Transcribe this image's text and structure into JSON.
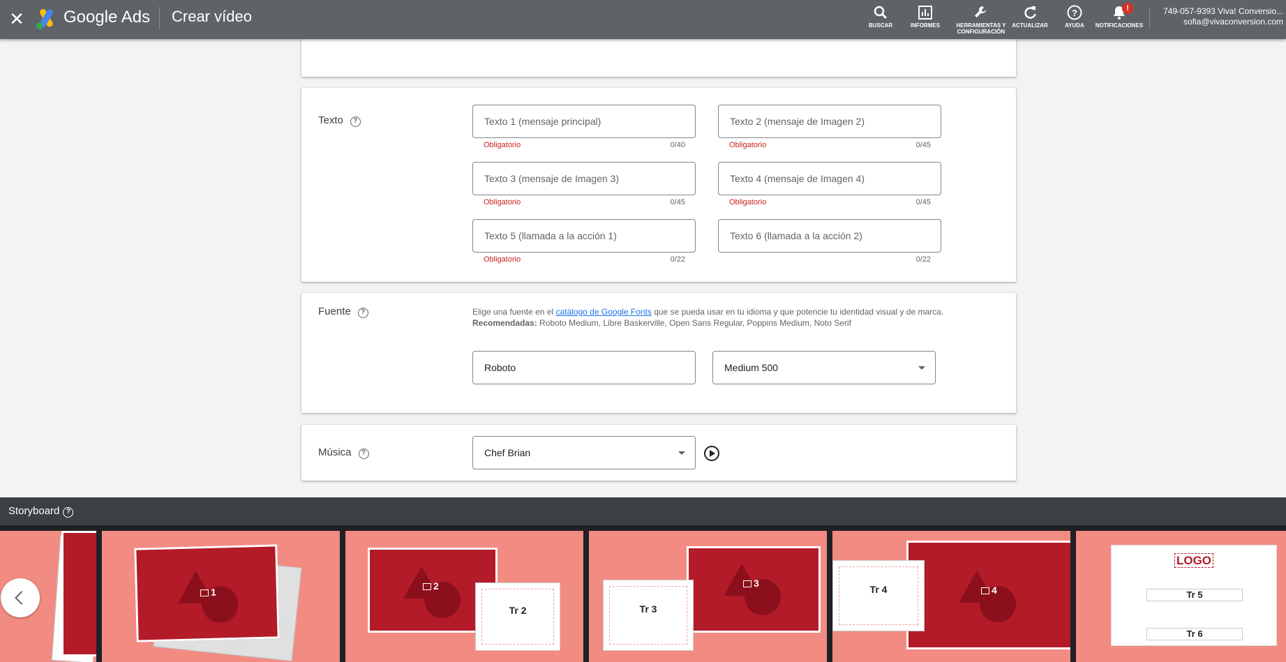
{
  "topbar": {
    "close_glyph": "✕",
    "brand": "Google Ads",
    "page_title": "Crear vídeo",
    "tools": [
      {
        "label": "BUSCAR",
        "icon": "search-icon"
      },
      {
        "label": "INFORMES",
        "icon": "reports-icon"
      },
      {
        "label": "HERRAMIENTAS Y CONFIGURACIÓN",
        "icon": "wrench-icon"
      },
      {
        "label": "ACTUALIZAR",
        "icon": "refresh-icon"
      },
      {
        "label": "AYUDA",
        "icon": "help-icon"
      },
      {
        "label": "NOTIFICACIONES",
        "icon": "bell-icon"
      }
    ],
    "notification_badge": "!",
    "account_line1": "749-057-9393 Viva! Conversio...",
    "account_line2": "sofia@vivaconversion.com"
  },
  "texto": {
    "label": "Texto",
    "help": "?",
    "fields": [
      {
        "placeholder": "Texto 1 (mensaje principal)",
        "hint": "Obligatorio",
        "count": "0/40"
      },
      {
        "placeholder": "Texto 2 (mensaje de Imagen 2)",
        "hint": "Obligatorio",
        "count": "0/45"
      },
      {
        "placeholder": "Texto 3 (mensaje de Imagen 3)",
        "hint": "Obligatorio",
        "count": "0/45"
      },
      {
        "placeholder": "Texto 4 (mensaje de Imagen 4)",
        "hint": "Obligatorio",
        "count": "0/45"
      },
      {
        "placeholder": "Texto 5 (llamada a la acción 1)",
        "hint": "Obligatorio",
        "count": "0/22"
      },
      {
        "placeholder": "Texto 6 (llamada a la acción 2)",
        "hint": "",
        "count": "0/22"
      }
    ]
  },
  "fuente": {
    "label": "Fuente",
    "help": "?",
    "desc_pre": "Elige una fuente en el ",
    "desc_link": "catálogo de Google Fonts",
    "desc_post": " que se pueda usar en tu idioma y que potencie tu identidad visual y de marca.",
    "recommended_label": "Recomendadas:",
    "recommended": " Roboto Medium, Libre Baskerville, Open Sans Regular, Poppins Medium, Noto Serif",
    "family_value": "Roboto",
    "weight_value": "Medium 500"
  },
  "musica": {
    "label": "Música",
    "help": "?",
    "track_value": "Chef Brian"
  },
  "storyboard": {
    "title": "Storyboard",
    "help": "?",
    "scene_1": "1",
    "scene_2": "2",
    "scene_3": "3",
    "scene_4": "4",
    "tr_2": "Tr 2",
    "tr_3": "Tr 3",
    "tr_4": "Tr 4",
    "tr_5": "Tr 5",
    "tr_6": "Tr 6",
    "logo": "LOGO"
  },
  "colors": {
    "topbar": "#5f6368",
    "scene_bg": "#f28b82",
    "photo": "#b31b28",
    "error": "#c5221f",
    "link": "#1a73e8"
  }
}
